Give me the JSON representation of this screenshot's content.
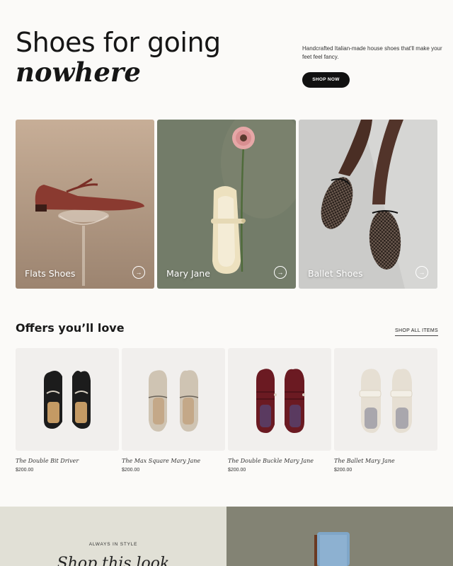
{
  "hero": {
    "title_line1": "Shoes for going",
    "title_line2": "nowhere",
    "description": "Handcrafted Italian-made house shoes that'll make your feet feel fancy.",
    "cta_label": "SHOP NOW"
  },
  "categories": [
    {
      "label": "Flats Shoes",
      "arrow": "→",
      "icon": "arrow-right-icon"
    },
    {
      "label": "Mary Jane",
      "arrow": "→",
      "icon": "arrow-right-icon"
    },
    {
      "label": "Ballet Shoes",
      "arrow": "→",
      "icon": "arrow-right-icon"
    }
  ],
  "offers": {
    "title": "Offers you’ll love",
    "shop_all_label": "SHOP ALL ITEMS",
    "products": [
      {
        "name": "The Double Bit Driver",
        "price": "$200.00",
        "color": "#1c1c1c"
      },
      {
        "name": "The Max Square Mary Jane",
        "price": "$200.00",
        "color": "#cfc4b3"
      },
      {
        "name": "The Double Buckle Mary Jane",
        "price": "$200.00",
        "color": "#6b1a22"
      },
      {
        "name": "The Ballet Mary Jane",
        "price": "$200.00",
        "color": "#e6dfd3"
      }
    ]
  },
  "promo": {
    "eyebrow": "ALWAYS IN STYLE",
    "title": "Shop this look"
  },
  "colors": {
    "background": "#fbfaf8",
    "cta_background": "#111111",
    "promo_background": "#e1e0d6",
    "card_flats_bg": "#b9a08a",
    "card_maryjane_bg": "#727a68",
    "card_ballet_bg": "#c9c9c7"
  }
}
